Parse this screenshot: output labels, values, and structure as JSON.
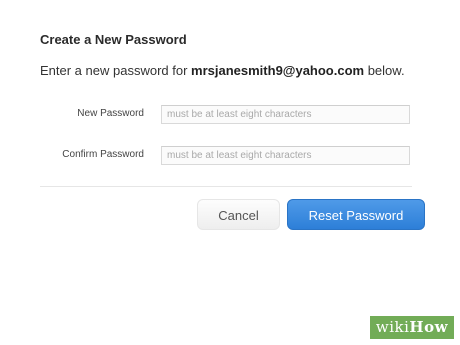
{
  "dialog": {
    "title": "Create a New Password",
    "intro_prefix": "Enter a new password for ",
    "email": "mrsjanesmith9@yahoo.com",
    "intro_suffix": " below."
  },
  "form": {
    "new_password_label": "New Password",
    "new_password_placeholder": "must be at least eight characters",
    "confirm_password_label": "Confirm Password",
    "confirm_password_placeholder": "must be at least eight characters"
  },
  "buttons": {
    "cancel": "Cancel",
    "reset": "Reset Password"
  },
  "watermark": {
    "wiki": "wiki",
    "how": "How"
  },
  "colors": {
    "primary_button": "#2d7fd8",
    "watermark_green": "#5a9e3a"
  }
}
